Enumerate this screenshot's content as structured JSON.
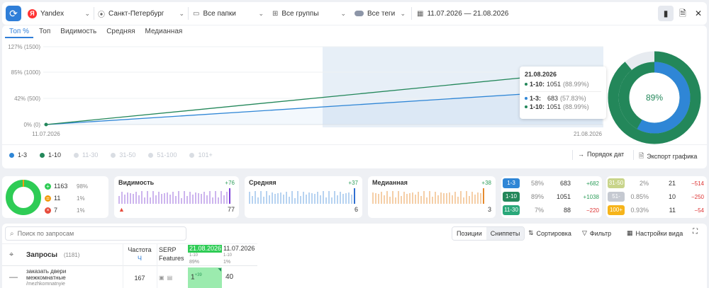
{
  "toolbar": {
    "search_engine": "Yandex",
    "region": "Санкт-Петербург",
    "folders": "Все папки",
    "groups": "Все группы",
    "tags": "Все теги",
    "date_range": "11.07.2026 — 21.08.2026"
  },
  "tabs": [
    "Топ %",
    "Топ",
    "Видимость",
    "Средняя",
    "Медианная"
  ],
  "chart": {
    "y_ticks": [
      "127% (1500)",
      "85% (1000)",
      "42% (500)",
      "0% (0)"
    ],
    "x_start": "11.07.2026",
    "x_end": "21.08.2026",
    "tooltip": {
      "date": "21.08.2026",
      "line1_label": "1-10:",
      "line1_value": "1051",
      "line1_pct": "(88.99%)",
      "line2_label": "1-3:",
      "line2_value": "683",
      "line2_pct": "(57.83%)",
      "line3_label": "1-10:",
      "line3_value": "1051",
      "line3_pct": "(88.99%)"
    },
    "legend": [
      "1-3",
      "1-10",
      "11-30",
      "31-50",
      "51-100",
      "101+"
    ],
    "order_label": "Порядок дат",
    "export_label": "Экспорт графика",
    "donut_label": "89%"
  },
  "chart_data": {
    "type": "line",
    "x": [
      "11.07.2026",
      "21.08.2026"
    ],
    "series": [
      {
        "name": "1-3",
        "values": [
          0,
          683
        ],
        "color": "#2f86d6"
      },
      {
        "name": "1-10",
        "values": [
          0,
          1051
        ],
        "color": "#23875a"
      }
    ],
    "ylim": [
      0,
      1500
    ],
    "donut": {
      "value_pct": 89,
      "inner_pct": 58
    }
  },
  "stats": {
    "ok_count": "1163",
    "ok_pct": "98%",
    "warn_count": "11",
    "warn_pct": "1%",
    "err_count": "7",
    "err_pct": "1%",
    "visibility_label": "Видимость",
    "visibility_delta": "+76",
    "visibility_value": "77",
    "avg_label": "Средняя",
    "avg_delta": "+37",
    "avg_value": "6",
    "median_label": "Медианная",
    "median_delta": "+38",
    "median_value": "3"
  },
  "ranks_left": [
    {
      "label": "1-3",
      "pct": "58%",
      "value": "683",
      "delta": "+682",
      "color": "#2f86d6"
    },
    {
      "label": "1-10",
      "pct": "89%",
      "value": "1051",
      "delta": "+1038",
      "color": "#23875a"
    },
    {
      "label": "11-30",
      "pct": "7%",
      "value": "88",
      "delta": "−220",
      "color": "#2aa87a"
    }
  ],
  "ranks_right": [
    {
      "label": "31-50",
      "pct": "2%",
      "value": "21",
      "delta": "−514",
      "color": "#c8d48a"
    },
    {
      "label": "51-100",
      "pct": "0.85%",
      "value": "10",
      "delta": "−250",
      "color": "#c5c9d1"
    },
    {
      "label": "100+",
      "pct": "0.93%",
      "value": "11",
      "delta": "−54",
      "color": "#f6b41a"
    }
  ],
  "table": {
    "search_placeholder": "Поиск по запросам",
    "positions_tab": "Позиции",
    "snippets_tab": "Сниппеты",
    "sort_label": "Сортировка",
    "filter_label": "Фильтр",
    "view_settings_label": "Настройки вида",
    "col_queries": "Запросы",
    "col_queries_count": "(1181)",
    "col_freq": "Частота",
    "col_freq_sub": "Ч",
    "col_serp": "SERP",
    "col_serp2": "Features",
    "date1": "21.08.2026",
    "date1_sub1": "1-10",
    "date1_sub2": "89%",
    "date2": "11.07.2026",
    "date2_sub1": "1-10",
    "date2_sub2": "1%",
    "row1": {
      "query_l1": "заказать двери",
      "query_l2": "межкомнатные",
      "url": "/mezhkomnatnyie",
      "freq": "167",
      "pos_now": "1",
      "pos_delta": "+39",
      "pos_prev": "40"
    }
  }
}
